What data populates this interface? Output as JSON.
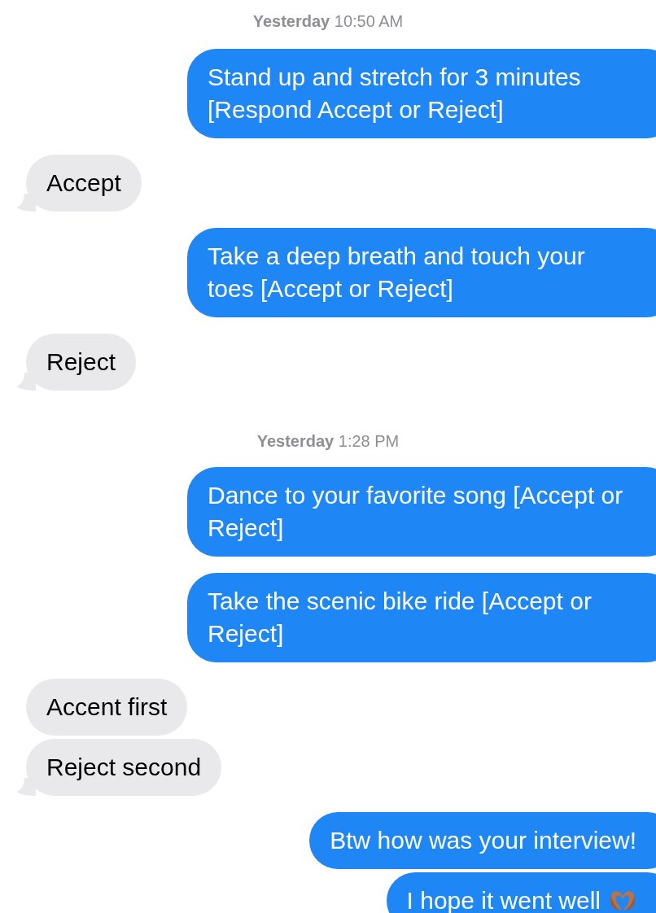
{
  "messages": [
    {
      "kind": "timestamp",
      "text": "**Yesterday** 10:50 AM"
    },
    {
      "kind": "outgoing",
      "bubbles": [
        {
          "text": "Stand up and stretch for 3 minutes [Respond Accept or Reject]"
        }
      ]
    },
    {
      "kind": "incoming",
      "bubbles": [
        {
          "text": "Accept"
        }
      ]
    },
    {
      "kind": "outgoing",
      "bubbles": [
        {
          "text": "Take a deep breath and touch your toes [Accept or Reject]"
        }
      ]
    },
    {
      "kind": "incoming",
      "bubbles": [
        {
          "text": "Reject"
        }
      ]
    },
    {
      "kind": "timestamp",
      "text": "**Yesterday** 1:28 PM"
    },
    {
      "kind": "outgoing",
      "bubbles": [
        {
          "text": "Dance to your favorite song [Accept or Reject]"
        }
      ]
    },
    {
      "kind": "outgoing",
      "bubbles": [
        {
          "text": "Take the scenic bike ride [Accept or Reject]"
        }
      ]
    },
    {
      "kind": "incoming",
      "bubbles": [
        {
          "text": "Accent first"
        },
        {
          "text": "Reject second"
        }
      ]
    },
    {
      "kind": "outgoing",
      "bubbles": [
        {
          "text": "Btw how was your interview!"
        },
        {
          "text": "I hope it went well",
          "kind": "heart-hands"
        }
      ]
    }
  ]
}
